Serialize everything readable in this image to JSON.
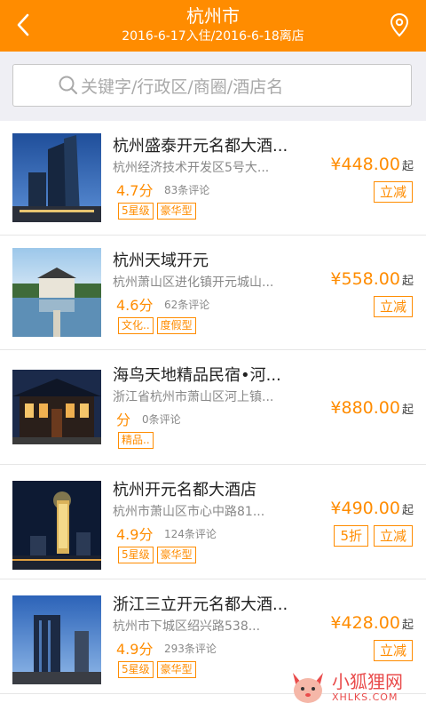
{
  "header": {
    "title": "杭州市",
    "subtitle": "2016-6-17入住/2016-6-18离店",
    "back_icon": "chevron-left-icon",
    "location_icon": "map-pin-icon",
    "bg_color": "#ff8c00"
  },
  "search": {
    "placeholder": "关键字/行政区/商圈/酒店名",
    "icon": "search-icon"
  },
  "hotels": [
    {
      "name": "杭州盛泰开元名都大酒...",
      "address": "杭州经济技术开发区5号大...",
      "score": "4.7分",
      "reviews": "83条评论",
      "tags": [
        "5星级",
        "豪华型"
      ],
      "price": "¥448.00",
      "price_suffix": "起",
      "buttons": [
        "立减"
      ]
    },
    {
      "name": "杭州天域开元",
      "address": "杭州萧山区进化镇开元城山...",
      "score": "4.6分",
      "reviews": "62条评论",
      "tags": [
        "文化..",
        "度假型"
      ],
      "price": "¥558.00",
      "price_suffix": "起",
      "buttons": [
        "立减"
      ]
    },
    {
      "name": "海鸟天地精品民宿•河...",
      "address": "浙江省杭州市萧山区河上镇...",
      "score": "分",
      "reviews": "0条评论",
      "tags": [
        "精品.."
      ],
      "price": "¥880.00",
      "price_suffix": "起",
      "buttons": []
    },
    {
      "name": "杭州开元名都大酒店",
      "address": "杭州市萧山区市心中路81...",
      "score": "4.9分",
      "reviews": "124条评论",
      "tags": [
        "5星级",
        "豪华型"
      ],
      "price": "¥490.00",
      "price_suffix": "起",
      "buttons": [
        "5折",
        "立减"
      ]
    },
    {
      "name": "浙江三立开元名都大酒...",
      "address": "杭州市下城区绍兴路538...",
      "score": "4.9分",
      "reviews": "293条评论",
      "tags": [
        "5星级",
        "豪华型"
      ],
      "price": "¥428.00",
      "price_suffix": "起",
      "buttons": [
        "立减"
      ]
    }
  ],
  "watermark": {
    "text": "小狐狸网",
    "url": "XHLKS.COM",
    "icon": "fox-logo-icon"
  },
  "colors": {
    "accent": "#ff8c00",
    "text": "#222222",
    "muted": "#888888"
  }
}
